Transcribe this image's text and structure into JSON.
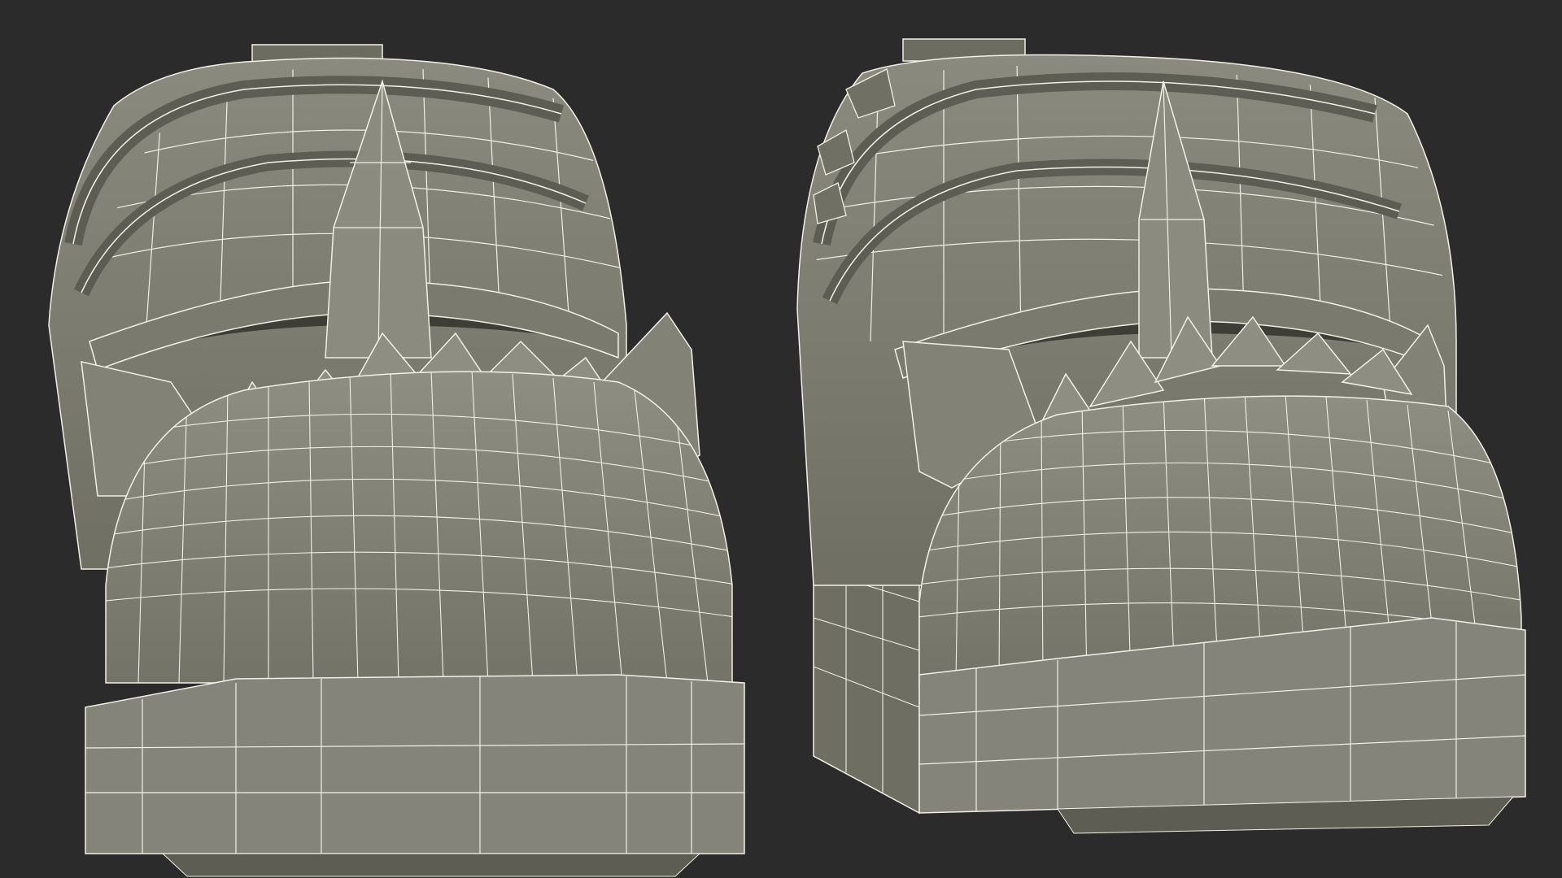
{
  "scene": {
    "background_color": "#2b2b2b",
    "mesh_fill_color": "#7b7b6f",
    "mesh_shadow_color": "#5a5a50",
    "mesh_highlight_color": "#96968a",
    "wireframe_color": "#f2f0e6",
    "objects": [
      {
        "name": "left-shoe-front-view"
      },
      {
        "name": "right-shoe-three-quarter-view"
      }
    ]
  }
}
